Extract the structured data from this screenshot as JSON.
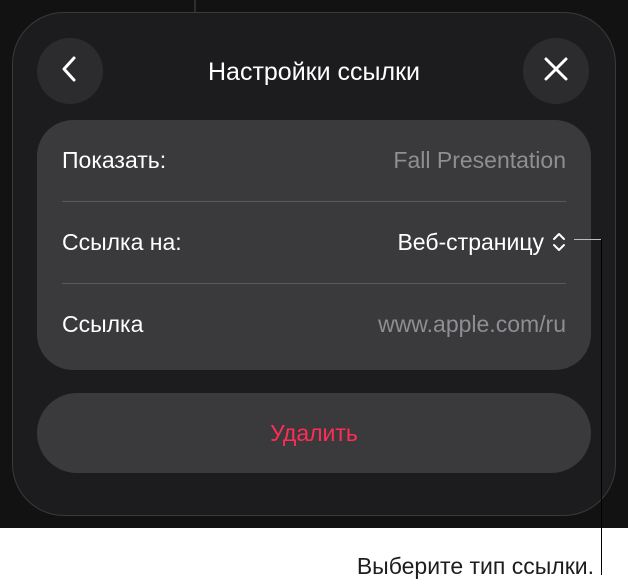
{
  "header": {
    "title": "Настройки ссылки"
  },
  "fields": {
    "display": {
      "label": "Показать:",
      "value": "Fall Presentation"
    },
    "link_to": {
      "label": "Ссылка на:",
      "value": "Веб-страницу"
    },
    "link": {
      "label": "Ссылка",
      "placeholder": "www.apple.com/ru"
    }
  },
  "actions": {
    "delete_label": "Удалить"
  },
  "callout": {
    "text": "Выберите тип ссылки."
  },
  "icons": {
    "back": "chevron-left-icon",
    "close": "close-icon",
    "stepper": "chevron-up-down-icon"
  },
  "colors": {
    "panel": "#1c1c1e",
    "card": "#3a3a3c",
    "destructive": "#ff2d55",
    "muted": "#8e8e93"
  }
}
